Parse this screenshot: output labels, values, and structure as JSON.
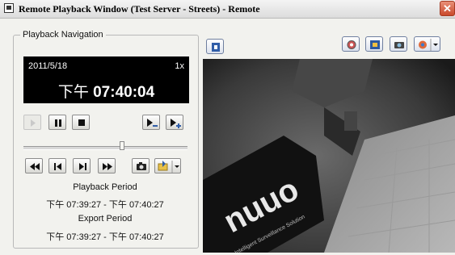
{
  "window": {
    "title": "Remote Playback Window (Test Server - Streets) - Remote",
    "close_glyph": "✕"
  },
  "navigation": {
    "group_label": "Playback Navigation",
    "date": "2011/5/18",
    "speed": "1x",
    "time_prefix": "下午",
    "time": "07:40:04",
    "slider_position": 0.6
  },
  "info": {
    "playback_period_label": "Playback Period",
    "playback_period_value": "下午 07:39:27 - 下午 07:40:27",
    "export_period_label": "Export Period",
    "export_period_value": "下午 07:39:27 - 下午 07:40:27"
  },
  "video": {
    "logo_text": "nuuo",
    "logo_subtext": "The Intelligent Surveillance Solution"
  },
  "colors": {
    "accent": "#315ea8",
    "display_bg": "#000000",
    "close": "#d45a3c"
  },
  "icons": [
    "snap-icon",
    "camera-icon",
    "export-icon",
    "fullscreen-icon",
    "settings-icon"
  ]
}
